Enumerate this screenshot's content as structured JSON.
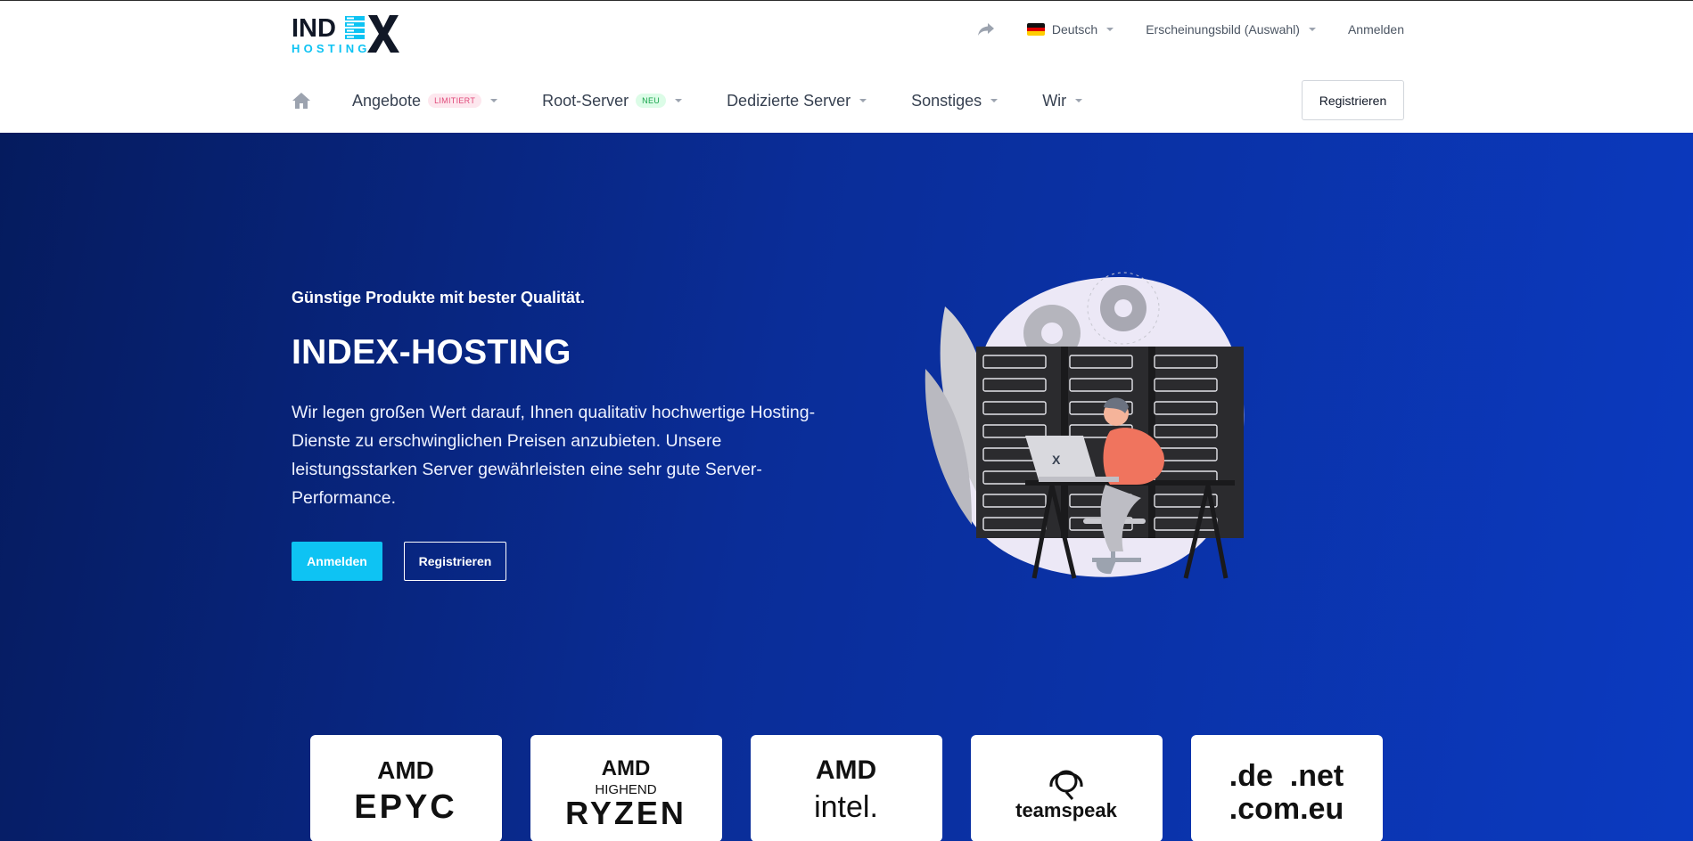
{
  "header": {
    "logo_text": "INDEX HOSTING",
    "topbar": {
      "share_icon": "share-icon",
      "language": "Deutsch",
      "appearance": "Erscheinungsbild (Auswahl)",
      "login": "Anmelden"
    },
    "nav": {
      "home_icon": "home-icon",
      "items": [
        {
          "label": "Angebote",
          "badge": "LIMITIERT"
        },
        {
          "label": "Root-Server",
          "badge": "NEU"
        },
        {
          "label": "Dedizierte Server",
          "badge": ""
        },
        {
          "label": "Sonstiges",
          "badge": ""
        },
        {
          "label": "Wir",
          "badge": ""
        }
      ],
      "register": "Registrieren"
    }
  },
  "hero": {
    "subtitle": "Günstige Produkte mit bester Qualität.",
    "title": "INDEX-HOSTING",
    "text": "Wir legen großen Wert darauf, Ihnen qualitativ hochwertige Hosting-Dienste zu erschwinglichen Preisen anzubieten. Unsere leistungsstarken Server gewährleisten eine sehr gute Server-Performance.",
    "login_button": "Anmelden",
    "register_button": "Registrieren"
  },
  "partners": [
    {
      "line1": "AMD",
      "line2": "EPYC"
    },
    {
      "line1": "AMD",
      "line_mid": "HIGHEND",
      "line2": "RYZEN"
    },
    {
      "line1": "AMD",
      "line2": "intel."
    },
    {
      "line1": "",
      "line2": "teamspeak"
    },
    {
      "line1": ".de  .net",
      "line2": ".com.eu"
    }
  ],
  "colors": {
    "accent": "#0ec3f3",
    "hero_dark": "#051b5e",
    "hero_light": "#0b3ac0",
    "badge_pink": "#e04a7a",
    "badge_green": "#16a34a"
  }
}
